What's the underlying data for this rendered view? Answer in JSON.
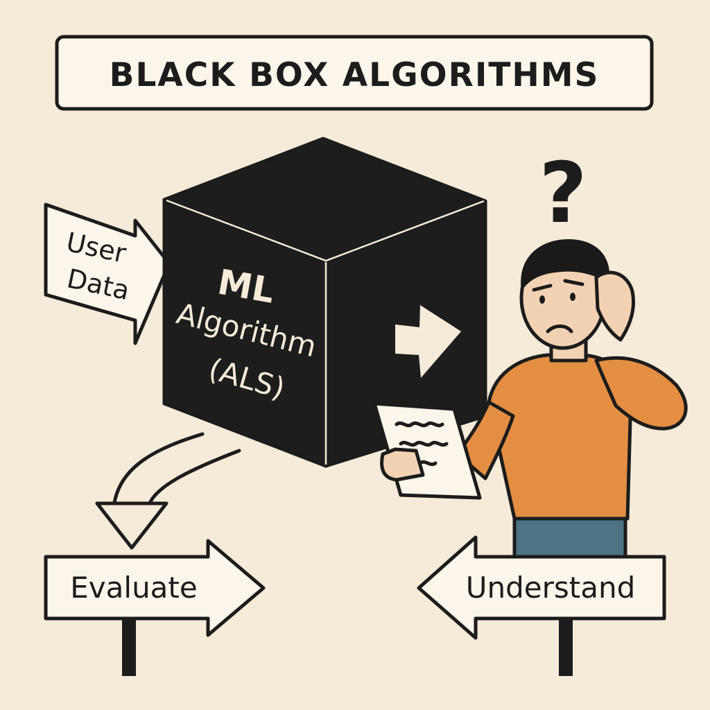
{
  "title": "BLACK BOX ALGORITHMS",
  "input_arrow": {
    "line1": "User",
    "line2": "Data"
  },
  "black_box": {
    "line1": "ML",
    "line2": "Algorithm",
    "line3": "(ALS)"
  },
  "person": {
    "question_mark": "?"
  },
  "signs": {
    "left": "Evaluate",
    "right": "Understand"
  },
  "colors": {
    "background": "#f6ead8",
    "ink": "#1c1c1c",
    "cube": "#1d1d1d",
    "sign_fill": "#fbf5ea",
    "shirt": "#e38e43",
    "pants": "#4e7385",
    "skin": "#f3d2b3",
    "hair": "#1a1a1a"
  }
}
